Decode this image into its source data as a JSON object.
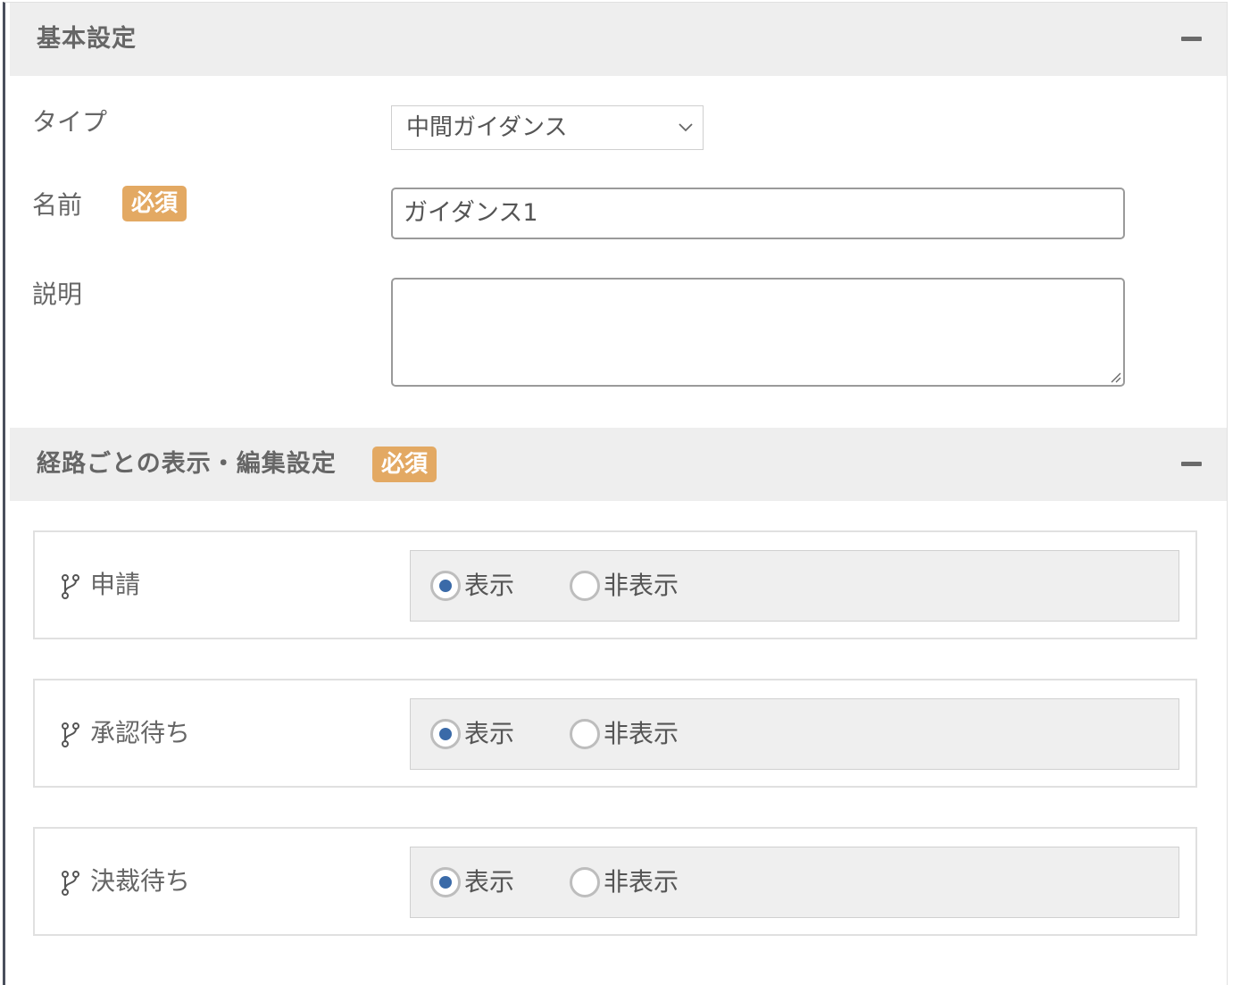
{
  "basic_section": {
    "title": "基本設定",
    "type_label": "タイプ",
    "type_value": "中間ガイダンス",
    "name_label": "名前",
    "name_required": "必須",
    "name_value": "ガイダンス1",
    "description_label": "説明",
    "description_value": ""
  },
  "route_section": {
    "title": "経路ごとの表示・編集設定",
    "required": "必須",
    "routes": [
      {
        "label": "申請",
        "options": [
          "表示",
          "非表示"
        ],
        "selected": "表示"
      },
      {
        "label": "承認待ち",
        "options": [
          "表示",
          "非表示"
        ],
        "selected": "表示"
      },
      {
        "label": "決裁待ち",
        "options": [
          "表示",
          "非表示"
        ],
        "selected": "表示"
      }
    ]
  },
  "colors": {
    "badge": "#e3a963",
    "radio_selected": "#3a6aa8",
    "header_bg": "#eeeeee"
  },
  "icons": {
    "collapse": "minus-icon",
    "select": "chevron-down-icon",
    "route": "branch-icon"
  }
}
